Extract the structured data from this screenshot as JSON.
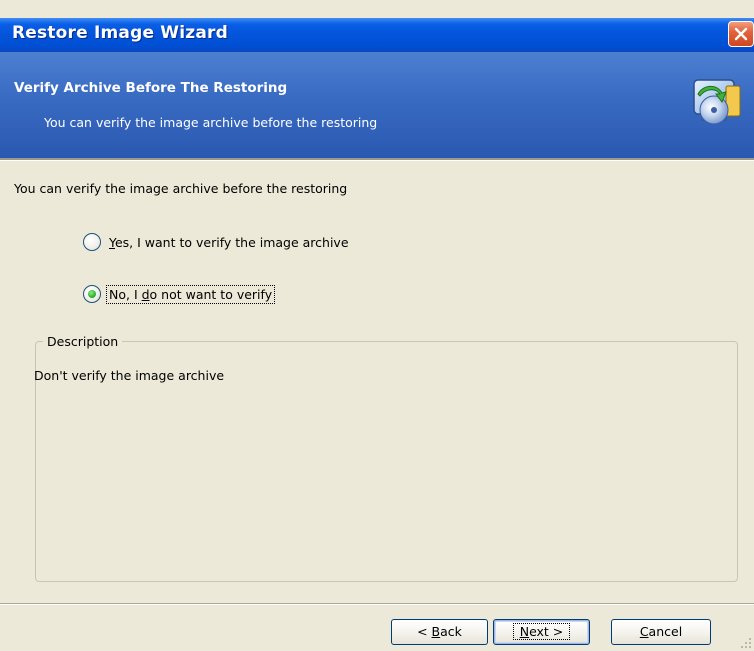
{
  "window": {
    "title": "Restore Image Wizard"
  },
  "banner": {
    "title": "Verify Archive Before The Restoring",
    "subtitle": "You can verify the image archive before the restoring",
    "icon": "restore-disk-icon"
  },
  "content": {
    "prompt": "You can verify the image archive before the restoring",
    "options": [
      {
        "mnemonic": "Y",
        "label_rest": "es, I want to verify the image archive",
        "selected": false
      },
      {
        "label_pre": "No, I ",
        "mnemonic": "d",
        "label_rest": "o not want to verify",
        "selected": true
      }
    ]
  },
  "description": {
    "legend": "Description",
    "text": "Don't verify the image archive"
  },
  "buttons": {
    "back": {
      "pre": "< ",
      "mnemonic": "B",
      "rest": "ack"
    },
    "next": {
      "mnemonic": "N",
      "rest": "ext >"
    },
    "cancel": {
      "mnemonic": "C",
      "rest": "ancel"
    }
  },
  "colors": {
    "titlebar": "#0254d9",
    "banner": "#3a6cc4",
    "dialog_bg": "#ece9d8",
    "close_button": "#e3643d",
    "radio_selected": "#2fb42f"
  }
}
